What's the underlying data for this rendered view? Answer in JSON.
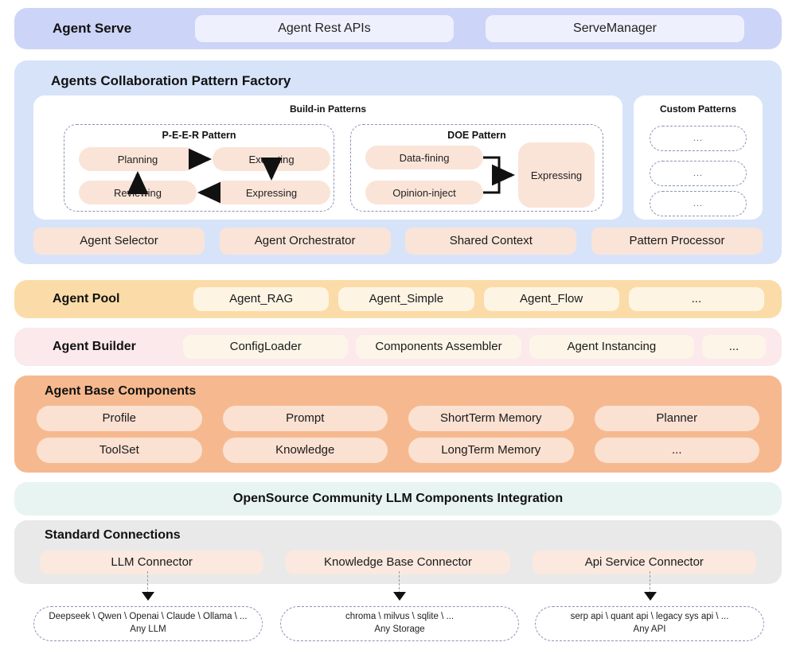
{
  "agent_serve": {
    "title": "Agent Serve",
    "items": [
      "Agent Rest APIs",
      "ServeManager"
    ]
  },
  "factory": {
    "title": "Agents Collaboration Pattern Factory",
    "builtin_title": "Build-in Patterns",
    "custom_title": "Custom Patterns",
    "peer": {
      "title": "P-E-E-R Pattern",
      "nodes": {
        "planning": "Planning",
        "executing": "Executing",
        "reviewing": "Reviewing",
        "expressing": "Expressing"
      }
    },
    "doe": {
      "title": "DOE Pattern",
      "nodes": {
        "data_fining": "Data-fining",
        "opinion_inject": "Opinion-inject",
        "expressing": "Expressing"
      }
    },
    "custom_patterns": [
      "...",
      "...",
      "..."
    ],
    "bottom_items": [
      "Agent Selector",
      "Agent Orchestrator",
      "Shared Context",
      "Pattern Processor"
    ]
  },
  "agent_pool": {
    "title": "Agent Pool",
    "items": [
      "Agent_RAG",
      "Agent_Simple",
      "Agent_Flow",
      "..."
    ]
  },
  "agent_builder": {
    "title": "Agent Builder",
    "items": [
      "ConfigLoader",
      "Components Assembler",
      "Agent Instancing",
      "..."
    ]
  },
  "base_components": {
    "title": "Agent Base Components",
    "row0": [
      "Profile",
      "Prompt",
      "ShortTerm Memory",
      "Planner"
    ],
    "row1": [
      "ToolSet",
      "Knowledge",
      "LongTerm Memory",
      "..."
    ]
  },
  "opensource": {
    "title": "OpenSource Community LLM Components Integration"
  },
  "standard_connections": {
    "title": "Standard Connections",
    "items": [
      "LLM Connector",
      "Knowledge Base Connector",
      "Api Service Connector"
    ]
  },
  "terminals": [
    {
      "main": "Deepseek \\ Qwen \\ Openai \\ Claude \\ Ollama \\ ...",
      "sub": "Any LLM"
    },
    {
      "main": "chroma \\ milvus \\ sqlite \\ ...",
      "sub": "Any Storage"
    },
    {
      "main": "serp api \\ quant api \\ legacy sys api \\  ...",
      "sub": "Any API"
    }
  ],
  "colors": {
    "serve_band": "#ccd4f7",
    "factory_band": "#d7e3f9",
    "pool_band": "#fbdca8",
    "builder_band": "#fbe9ec",
    "base_band": "#f6b98f",
    "opensource_band": "#e8f4f2",
    "connections_band": "#e9e9e9",
    "node_peach": "#fae4d8",
    "dashed_border": "#8a93b5"
  }
}
